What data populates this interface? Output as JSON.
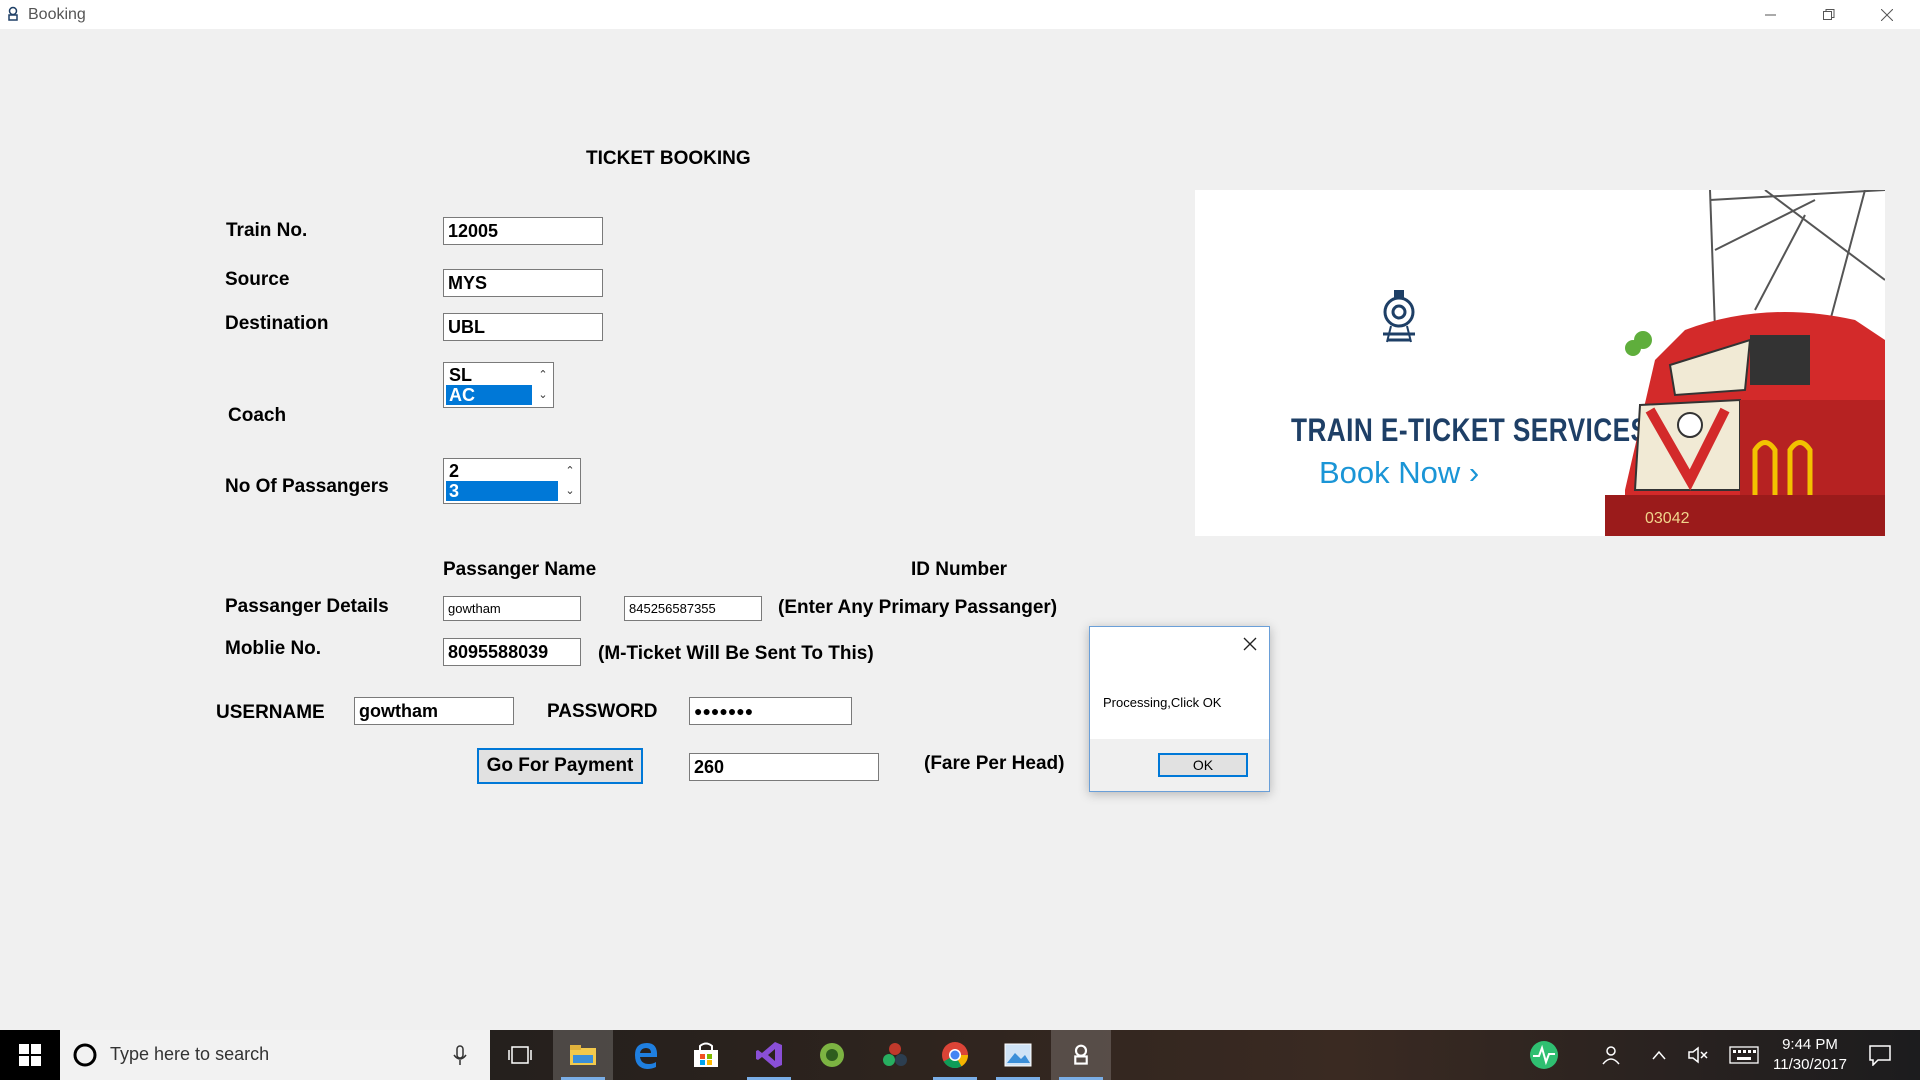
{
  "window": {
    "title": "Booking"
  },
  "form": {
    "heading": "TICKET BOOKING",
    "train_no": {
      "label": "Train No.",
      "value": "12005"
    },
    "source": {
      "label": "Source",
      "value": "MYS"
    },
    "destination": {
      "label": "Destination",
      "value": "UBL"
    },
    "coach": {
      "label": "Coach",
      "options": [
        "SL",
        "AC"
      ],
      "selected": "AC"
    },
    "passengers": {
      "label": "No Of Passangers",
      "options": [
        "2",
        "3"
      ],
      "selected": "3"
    },
    "passenger_name_header": "Passanger Name",
    "id_number_header": "ID Number",
    "passenger_details": {
      "label": "Passanger Details",
      "name": "gowtham",
      "id": "845256587355",
      "hint": "(Enter Any Primary Passanger)"
    },
    "mobile": {
      "label": "Moblie No.",
      "value": "8095588039",
      "hint": "(M-Ticket Will Be Sent To This)"
    },
    "username": {
      "label": "USERNAME",
      "value": "gowtham"
    },
    "password": {
      "label": "PASSWORD",
      "value": "●●●●●●●"
    },
    "payment_button": "Go For Payment",
    "fare": {
      "value": "260",
      "label": "(Fare Per Head)"
    }
  },
  "banner": {
    "headline": "TRAIN E-TICKET SERVICES",
    "cta": "Book Now ›",
    "engine_number": "03042"
  },
  "dialog": {
    "message": "Processing,Click OK",
    "ok_label": "OK"
  },
  "taskbar": {
    "search_placeholder": "Type here to search",
    "time": "9:44 PM",
    "date": "11/30/2017"
  },
  "colors": {
    "selection": "#0078d7",
    "banner_headline": "#1e3f66",
    "banner_cta": "#1a95d6"
  }
}
